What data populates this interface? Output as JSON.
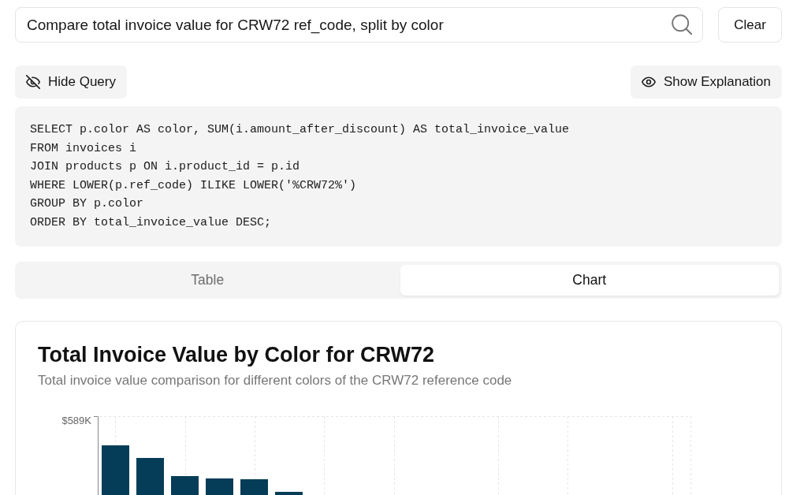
{
  "search": {
    "value": "Compare total invoice value for CRW72 ref_code, split by color",
    "button": "Clear"
  },
  "query_toggle": {
    "label": "Hide Query"
  },
  "explanation_toggle": {
    "label": "Show Explanation"
  },
  "sql": {
    "lines": [
      "SELECT p.color AS color, SUM(i.amount_after_discount) AS total_invoice_value",
      "FROM invoices i",
      "JOIN products p ON i.product_id = p.id",
      "WHERE LOWER(p.ref_code) ILIKE LOWER('%CRW72%')",
      "GROUP BY p.color",
      "ORDER BY total_invoice_value DESC;"
    ]
  },
  "view_tabs": [
    {
      "label": "Table",
      "selected": false
    },
    {
      "label": "Chart",
      "selected": true
    }
  ],
  "chart_card": {
    "title": "Total Invoice Value by Color for CRW72",
    "subtitle": "Total invoice value comparison for different colors of the CRW72 reference code",
    "y_tick_label": "$589K"
  }
}
